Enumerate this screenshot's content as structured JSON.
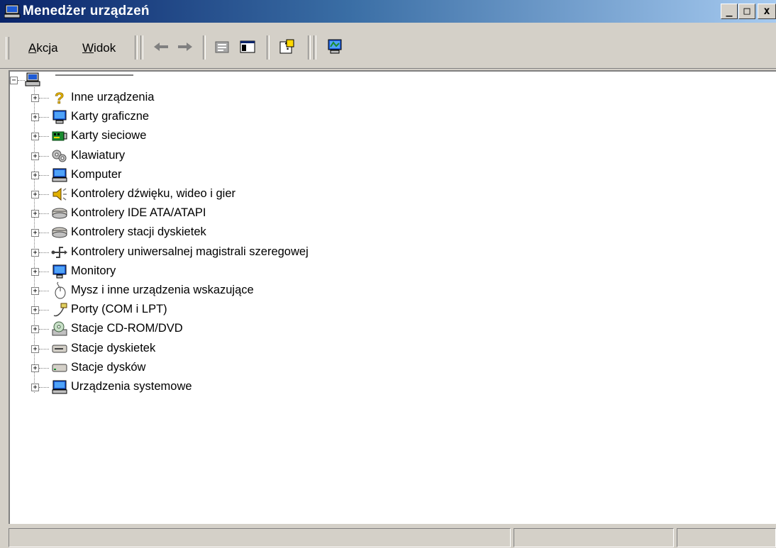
{
  "window": {
    "title": "Menedżer urządzeń"
  },
  "title_buttons": {
    "minimize": "_",
    "maximize": "□",
    "close": "x"
  },
  "menu": [
    {
      "label": "Akcja",
      "mnemonic": "A",
      "rest": "kcja"
    },
    {
      "label": "Widok",
      "mnemonic": "W",
      "rest": "idok"
    }
  ],
  "toolbar_icons": [
    "back-arrow-icon",
    "forward-arrow-icon",
    "properties-icon",
    "show-hide-tree-icon",
    "help-icon",
    "scan-hardware-icon"
  ],
  "tree": {
    "root_expander": "−",
    "items": [
      {
        "label": "Inne urządzenia",
        "icon": "question-mark-icon"
      },
      {
        "label": "Karty graficzne",
        "icon": "display-adapter-icon"
      },
      {
        "label": "Karty sieciowe",
        "icon": "network-card-icon"
      },
      {
        "label": "Klawiatury",
        "icon": "keyboard-icon"
      },
      {
        "label": "Komputer",
        "icon": "computer-icon"
      },
      {
        "label": "Kontrolery dźwięku, wideo i gier",
        "icon": "speaker-icon"
      },
      {
        "label": "Kontrolery IDE ATA/ATAPI",
        "icon": "ide-controller-icon"
      },
      {
        "label": "Kontrolery stacji dyskietek",
        "icon": "floppy-controller-icon"
      },
      {
        "label": "Kontrolery uniwersalnej magistrali szeregowej",
        "icon": "usb-icon"
      },
      {
        "label": "Monitory",
        "icon": "monitor-icon"
      },
      {
        "label": "Mysz i inne urządzenia wskazujące",
        "icon": "mouse-icon"
      },
      {
        "label": "Porty (COM i LPT)",
        "icon": "port-icon"
      },
      {
        "label": "Stacje CD-ROM/DVD",
        "icon": "cdrom-icon"
      },
      {
        "label": "Stacje dyskietek",
        "icon": "floppy-drive-icon"
      },
      {
        "label": "Stacje dysków",
        "icon": "disk-drive-icon"
      },
      {
        "label": "Urządzenia systemowe",
        "icon": "system-devices-icon"
      }
    ],
    "expander_symbol": "+"
  },
  "colors": {
    "title_start": "#0a246a",
    "title_end": "#a6caf0",
    "face": "#d4d0c8"
  }
}
